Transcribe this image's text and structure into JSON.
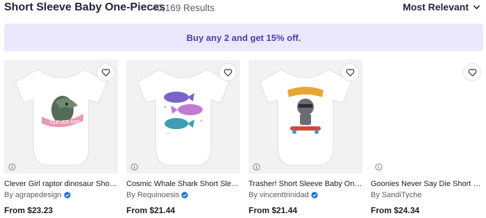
{
  "header": {
    "title": "Short Sleeve Baby One-Pieces",
    "results": "40,169 Results",
    "sort_label": "Most Relevant"
  },
  "promo": {
    "text": "Buy any 2 and get 15% off."
  },
  "colors": {
    "promo_bg": "#ebe8fb",
    "promo_text": "#4b3fae",
    "verified": "#1f6fd1"
  },
  "products": [
    {
      "name": "Clever Girl raptor dinosaur Short Sleeve Baby One-Piece",
      "by": "By",
      "artist": "agrapedesign",
      "price": "From $23.23",
      "icon": "raptor-design"
    },
    {
      "name": "Cosmic Whale Shark Short Sleeve Baby One-Piece",
      "by": "By",
      "artist": "Requinoesis",
      "price": "From $21.44",
      "icon": "whale-shark-design"
    },
    {
      "name": "Trasher! Short Sleeve Baby One-Piece",
      "by": "By",
      "artist": "vincenttrinidad",
      "price": "From $21.44",
      "icon": "raccoon-skateboard-design"
    },
    {
      "name": "Goonies Never Say Die Short Sleeve Baby One-Piece",
      "by": "By",
      "artist": "SandiTyche",
      "price": "From $24.34",
      "icon": "blank"
    }
  ]
}
